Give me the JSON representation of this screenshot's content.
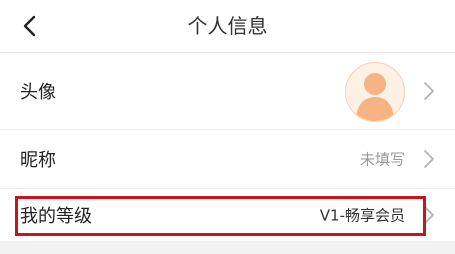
{
  "header": {
    "title": "个人信息",
    "back_icon": "chevron-left-icon"
  },
  "rows": [
    {
      "label": "头像",
      "value": "",
      "type": "avatar"
    },
    {
      "label": "昵称",
      "value": "未填写",
      "type": "text"
    },
    {
      "label": "我的等级",
      "value": "V1-畅享会员",
      "type": "text",
      "highlighted": true
    }
  ],
  "colors": {
    "highlight": "#c4161c",
    "avatar_bg": "#fdf0e4",
    "avatar_figure": "#f6b384",
    "chevron": "#b3b3b3"
  }
}
